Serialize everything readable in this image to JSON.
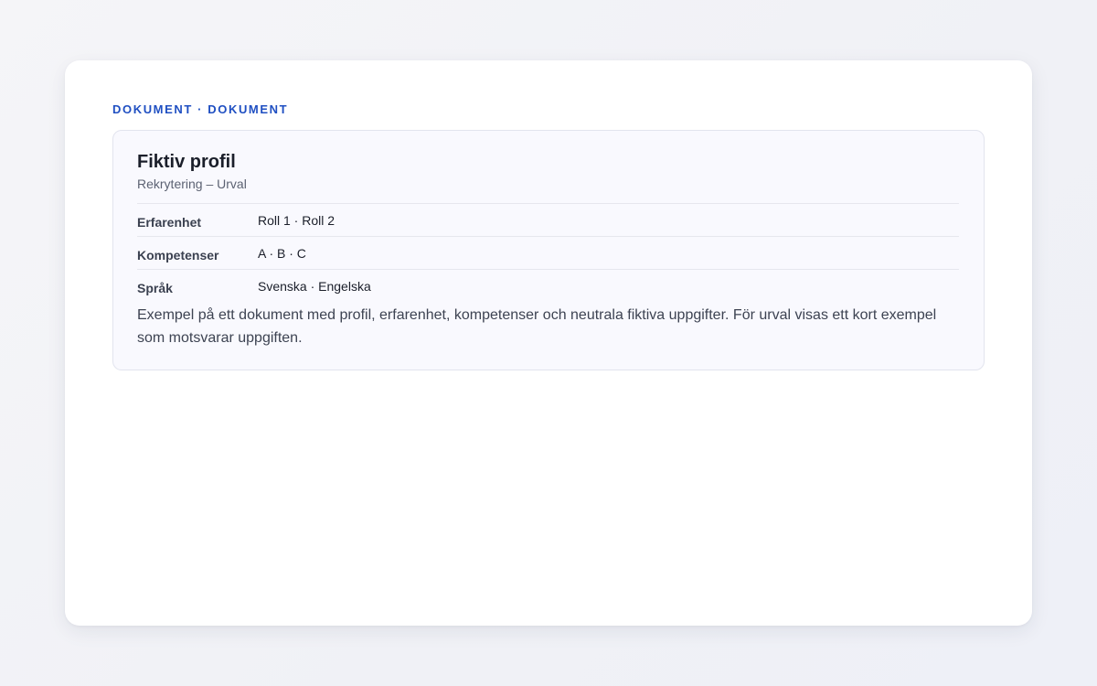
{
  "eyebrow": "DOKUMENT · DOKUMENT",
  "document": {
    "title": "Fiktiv profil",
    "subtitle": "Rekrytering – Urval",
    "rows": [
      {
        "label": "Erfarenhet",
        "value": "Roll 1 · Roll 2"
      },
      {
        "label": "Kompetenser",
        "value": "A · B · C"
      },
      {
        "label": "Språk",
        "value": "Svenska · Engelska"
      }
    ],
    "body": "Exempel på ett dokument med profil, erfarenhet, kompetenser och neutrala fiktiva uppgifter. För urval visas ett kort exempel som motsvarar uppgiften."
  },
  "colors": {
    "accent": "#1f4fc2",
    "background": "#f1f2f7",
    "card": "#ffffff",
    "panel": "#f9f9fe"
  }
}
